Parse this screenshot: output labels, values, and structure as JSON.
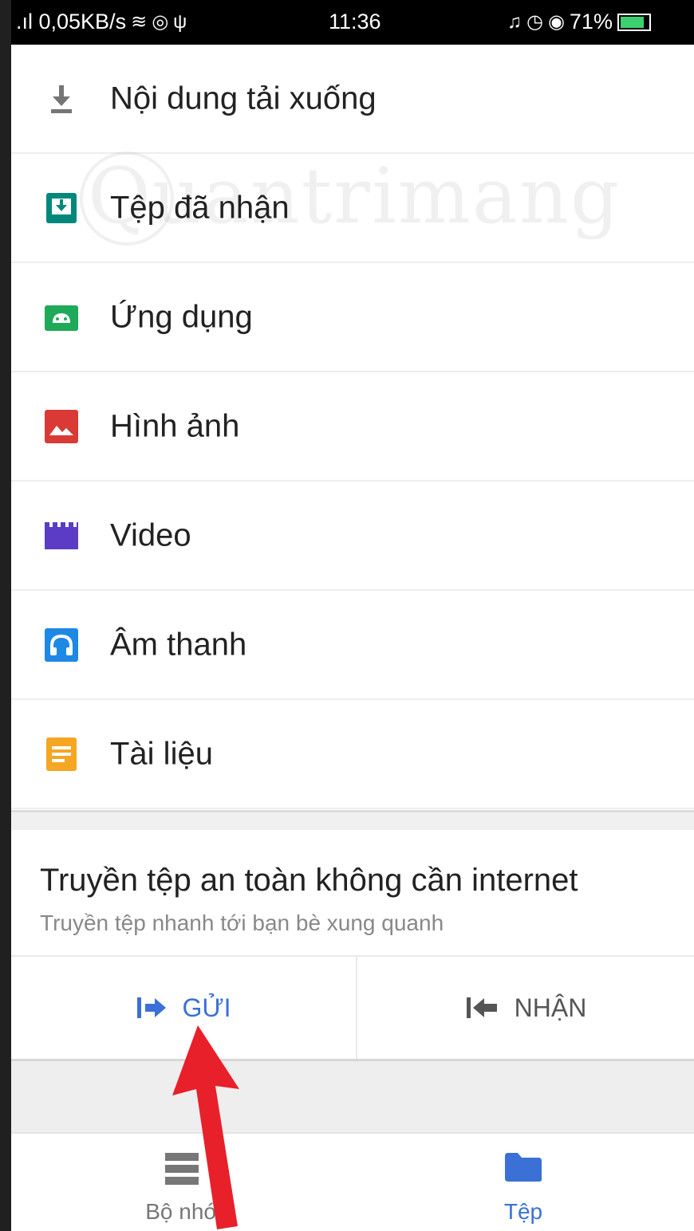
{
  "status_bar": {
    "left_text": ".ıl 0,05KB/s",
    "time": "11:36",
    "battery": "71%",
    "battery_color": "#3cd070"
  },
  "categories": [
    {
      "label": "Nội dung tải xuống",
      "icon": "download-icon",
      "color": "#757575"
    },
    {
      "label": "Tệp đã nhận",
      "icon": "received-files-icon",
      "color": "#00897b"
    },
    {
      "label": "Ứng dụng",
      "icon": "android-app-icon",
      "color": "#1faa59"
    },
    {
      "label": "Hình ảnh",
      "icon": "image-icon",
      "color": "#d93a35"
    },
    {
      "label": "Video",
      "icon": "video-icon",
      "color": "#5b3cc4"
    },
    {
      "label": "Âm thanh",
      "icon": "headphones-icon",
      "color": "#1e88e5"
    },
    {
      "label": "Tài liệu",
      "icon": "document-icon",
      "color": "#f5a623"
    }
  ],
  "transfer_card": {
    "title": "Truyền tệp an toàn không cần internet",
    "subtitle": "Truyền tệp nhanh tới bạn bè xung quanh",
    "send_label": "GỬI",
    "receive_label": "NHẬN",
    "accent": "#3b70d6"
  },
  "bottom_nav": {
    "storage_label": "Bộ nhớ",
    "files_label": "Tệp"
  },
  "watermark": "uantrimang",
  "annotation_arrow_color": "#e8202a"
}
